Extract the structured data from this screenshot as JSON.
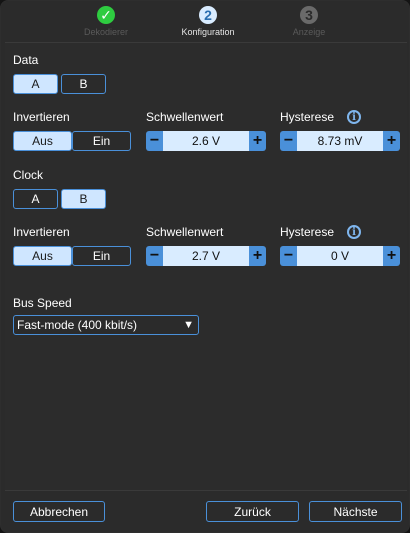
{
  "steps": [
    {
      "label": "Dekodierer",
      "symbol": "✓",
      "state": "done"
    },
    {
      "label": "Konfiguration",
      "symbol": "2",
      "state": "current"
    },
    {
      "label": "Anzeige",
      "symbol": "3",
      "state": "pending"
    }
  ],
  "data_section": {
    "title": "Data",
    "source_options": [
      "A",
      "B"
    ],
    "source_selected": "A",
    "invert_label": "Invertieren",
    "invert_options": [
      "Aus",
      "Ein"
    ],
    "invert_selected": "Aus",
    "threshold_label": "Schwellenwert",
    "threshold_value": "2.6 V",
    "hysteresis_label": "Hysterese",
    "hysteresis_value": "8.73 mV"
  },
  "clock_section": {
    "title": "Clock",
    "source_options": [
      "A",
      "B"
    ],
    "source_selected": "B",
    "invert_label": "Invertieren",
    "invert_options": [
      "Aus",
      "Ein"
    ],
    "invert_selected": "Aus",
    "threshold_label": "Schwellenwert",
    "threshold_value": "2.7 V",
    "hysteresis_label": "Hysterese",
    "hysteresis_value": "0 V"
  },
  "bus_speed": {
    "label": "Bus Speed",
    "selected": "Fast-mode (400 kbit/s)"
  },
  "icons": {
    "minus": "−",
    "plus": "+",
    "info": "i",
    "dropdown_arrow": "▼"
  },
  "footer": {
    "cancel_label": "Abbrechen",
    "back_label": "Zurück",
    "next_label": "Nächste"
  },
  "colors": {
    "accent": "#4a90d9",
    "active_fill": "#cfe6ff",
    "done_green": "#2ecc40",
    "background": "#2b2b2b"
  }
}
